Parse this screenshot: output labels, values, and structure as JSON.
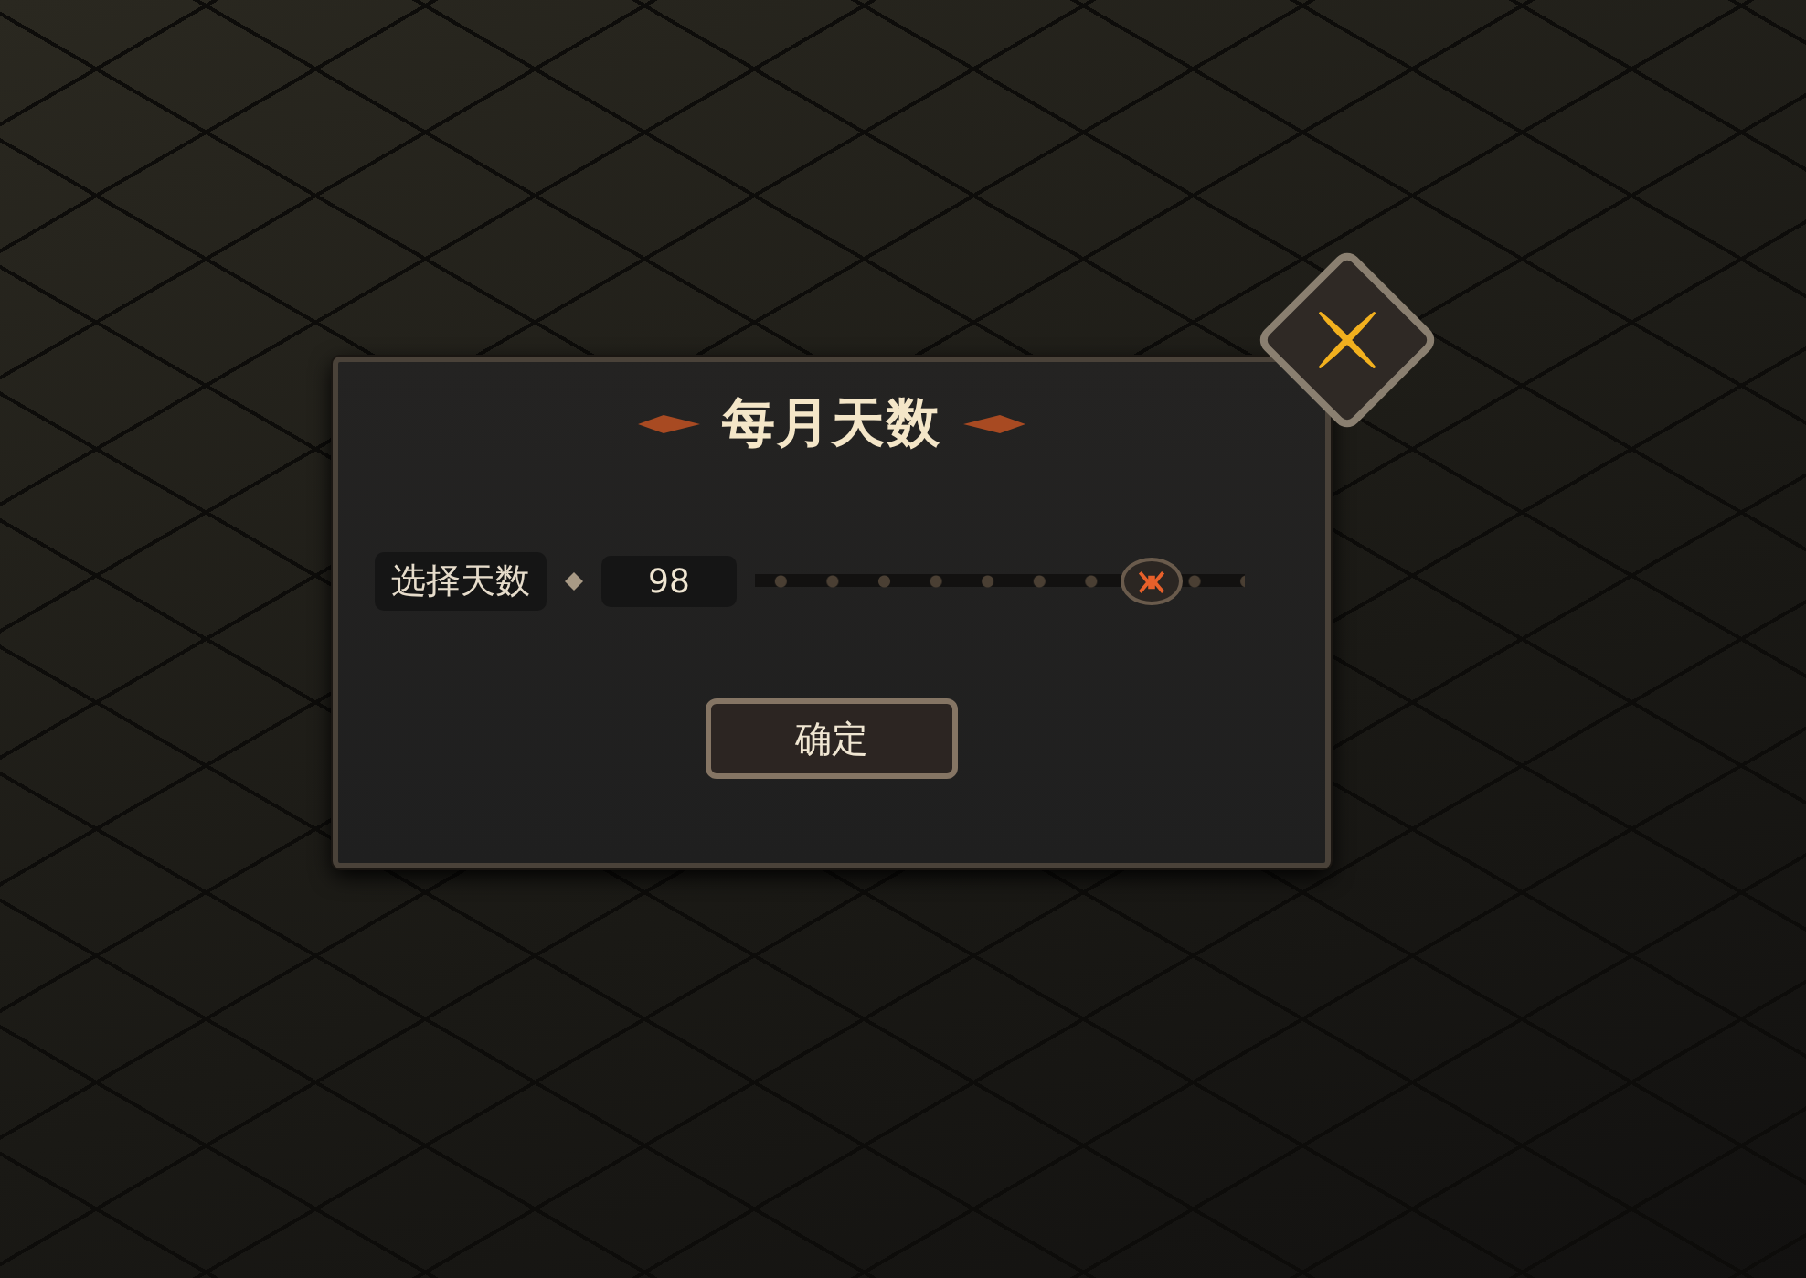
{
  "dialog": {
    "title": "每月天数",
    "setting": {
      "label": "选择天数",
      "value": "98",
      "level": 0.81
    },
    "confirm_button": "确定"
  }
}
